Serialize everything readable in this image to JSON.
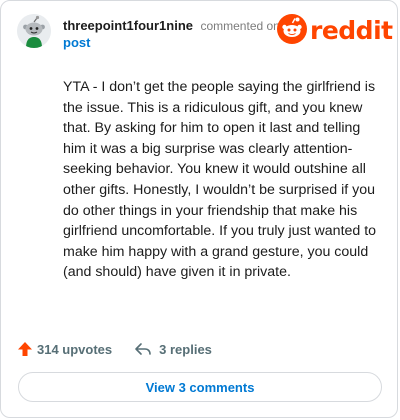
{
  "header": {
    "username": "threepoint1four1nine",
    "action": "commented on",
    "post_link": "post"
  },
  "logo": {
    "wordmark": "reddit",
    "icon": "reddit-snoo-icon",
    "color": "#ff4500"
  },
  "comment": {
    "avatar_icon": "snoo-avatar-icon",
    "text": "YTA - I don’t get the people saying the girlfriend is the issue. This is a ridiculous gift, and you knew that. By asking for him to open it last and telling him it was a big surprise was clearly attention-seeking behavior. You knew it would outshine all other gifts. Honestly, I wouldn’t be surprised if you do other things in your friendship that make his girlfriend uncomfortable. If you truly just wanted to make him happy with a grand gesture, you could (and should) have given it in private."
  },
  "footer": {
    "upvotes": "314 upvotes",
    "replies": "3 replies",
    "upvote_icon": "upvote-arrow-icon",
    "reply_icon": "reply-arrow-icon",
    "upvote_color": "#ff4500"
  },
  "view_button": {
    "label": "View 3 comments"
  },
  "colors": {
    "link": "#0079d3",
    "text": "#1c1c1c",
    "muted": "#576f76",
    "border": "#d7dade"
  }
}
